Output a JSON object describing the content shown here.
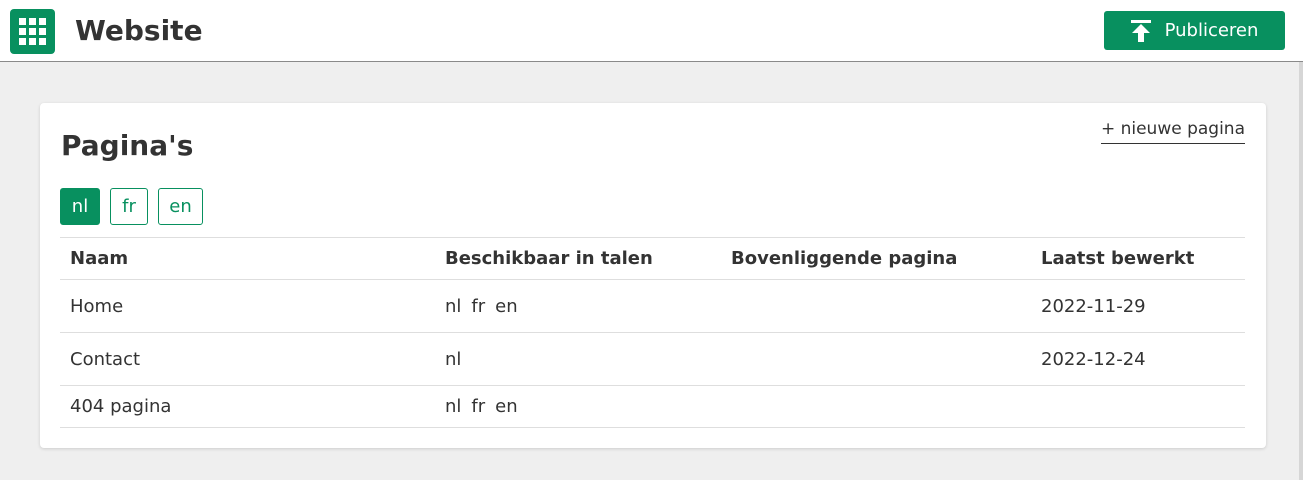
{
  "header": {
    "app_icon": "apps-grid-icon",
    "title": "Website",
    "publish_label": "Publiceren",
    "publish_icon": "upload-icon"
  },
  "colors": {
    "accent": "#08905f",
    "background": "#efefef",
    "text": "#333333"
  },
  "card": {
    "title": "Pagina's",
    "new_page_label": "+ nieuwe pagina",
    "language_tabs": [
      {
        "label": "nl",
        "active": true
      },
      {
        "label": "fr",
        "active": false
      },
      {
        "label": "en",
        "active": false
      }
    ],
    "table": {
      "columns": [
        "Naam",
        "Beschikbaar in talen",
        "Bovenliggende pagina",
        "Laatst bewerkt"
      ],
      "rows": [
        {
          "name": "Home",
          "languages": [
            "nl",
            "fr",
            "en"
          ],
          "parent": "",
          "edited": "2022-11-29"
        },
        {
          "name": "Contact",
          "languages": [
            "nl"
          ],
          "parent": "",
          "edited": "2022-12-24"
        },
        {
          "name": "404 pagina",
          "languages": [
            "nl",
            "fr",
            "en"
          ],
          "parent": "",
          "edited": ""
        }
      ]
    }
  }
}
